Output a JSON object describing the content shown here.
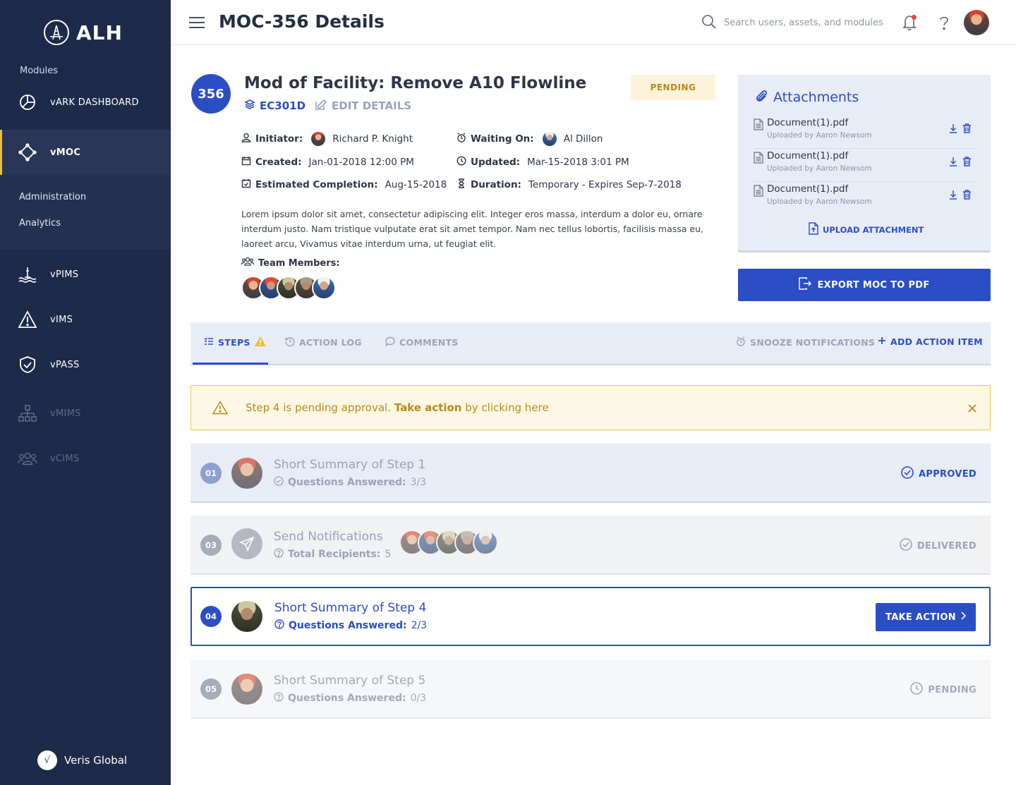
{
  "brand": {
    "name": "ALH"
  },
  "sidebar": {
    "modules_label": "Modules",
    "items": [
      {
        "label": "vARK DASHBOARD",
        "icon": "pie-chart-icon"
      },
      {
        "label": "vMOC",
        "icon": "diamond-node-icon",
        "active": true
      },
      {
        "label": "vPIMS",
        "icon": "oil-rig-icon"
      },
      {
        "label": "vIMS",
        "icon": "warning-triangle-icon"
      },
      {
        "label": "vPASS",
        "icon": "shield-check-icon"
      },
      {
        "label": "vMIMS",
        "icon": "org-chart-icon",
        "disabled": true
      },
      {
        "label": "vCIMS",
        "icon": "users-icon",
        "disabled": true
      }
    ],
    "subitems": [
      "Administration",
      "Analytics"
    ],
    "footer": "Veris Global"
  },
  "header": {
    "title": "MOC-356 Details",
    "search_placeholder": "Search users, assets, and modules"
  },
  "moc": {
    "number": "356",
    "title": "Mod of Facility: Remove A10 Flowline",
    "code": "EC301D",
    "edit_label": "EDIT DETAILS",
    "status": "PENDING",
    "initiator_label": "Initiator:",
    "initiator": "Richard P. Knight",
    "waiting_label": "Waiting On:",
    "waiting_on": "Al Dillon",
    "created_label": "Created:",
    "created": "Jan-01-2018 12:00 PM",
    "updated_label": "Updated:",
    "updated": "Mar-15-2018 3:01 PM",
    "est_label": "Estimated Completion:",
    "estimated_completion": "Aug-15-2018",
    "duration_label": "Duration:",
    "duration": "Temporary - Expires Sep-7-2018",
    "description": "Lorem ipsum dolor sit amet, consectetur adipiscing elit. Integer eros massa, interdum a dolor eu, ornare interdum justo. Nam tristique vulputate erat sit amet tempor. Nam nec tellus lobortis, facilisis massa eu, laoreet arcu, Vivamus vitae interdum urna, ut feugiat elit.",
    "team_label": "Team Members:"
  },
  "attachments": {
    "title": "Attachments",
    "files": [
      {
        "name": "Document(1).pdf",
        "uploaded_by": "Uploaded by Aaron Newsom"
      },
      {
        "name": "Document(1).pdf",
        "uploaded_by": "Uploaded by Aaron Newsom"
      },
      {
        "name": "Document(1).pdf",
        "uploaded_by": "Uploaded by Aaron Newsom"
      }
    ],
    "upload_label": "UPLOAD ATTACHMENT",
    "export_label": "EXPORT MOC TO PDF"
  },
  "tabs": {
    "steps": "STEPS",
    "action_log": "ACTION LOG",
    "comments": "COMMENTS",
    "snooze": "SNOOZE NOTIFICATIONS",
    "add_action": "ADD ACTION ITEM"
  },
  "alert": {
    "prefix": "Step 4 is pending approval.",
    "link": "Take action",
    "suffix": "by clicking here"
  },
  "steps": [
    {
      "num": "01",
      "title": "Short Summary of Step 1",
      "sub_label": "Questions Answered:",
      "sub_value": "3/3",
      "status": "APPROVED"
    },
    {
      "num": "03",
      "title": "Send Notifications",
      "sub_label": "Total Recipients:",
      "sub_value": "5",
      "status": "DELIVERED"
    },
    {
      "num": "04",
      "title": "Short Summary of Step 4",
      "sub_label": "Questions Answered:",
      "sub_value": "2/3",
      "action": "TAKE ACTION"
    },
    {
      "num": "05",
      "title": "Short Summary of Step 5",
      "sub_label": "Questions Answered:",
      "sub_value": "0/3",
      "status": "PENDING"
    }
  ],
  "colors": {
    "sidebar": "#1e2a4a",
    "primary": "#2c4ec4",
    "accent": "#f0b940",
    "pending": "#b98a19"
  }
}
